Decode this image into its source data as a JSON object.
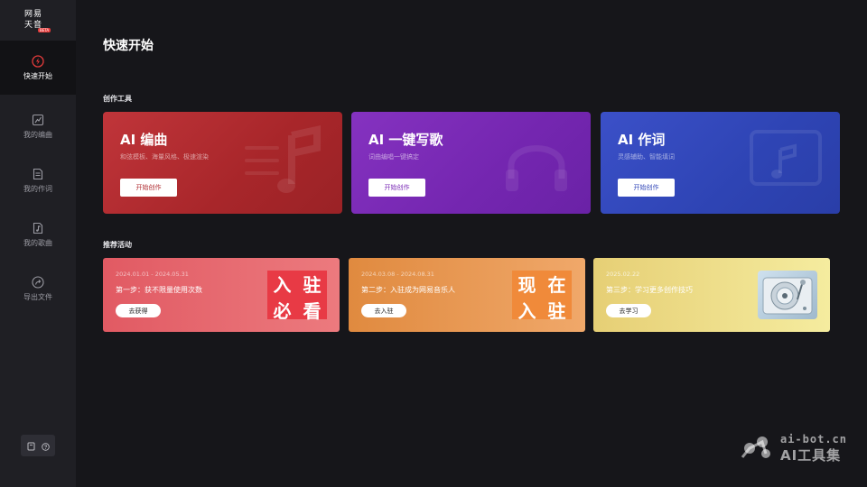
{
  "logo": {
    "line1": "网易",
    "line2": "天音",
    "badge": "BETA"
  },
  "sidebar": {
    "items": [
      {
        "label": "快速开始",
        "icon": "lightning-icon"
      },
      {
        "label": "我的编曲",
        "icon": "score-icon"
      },
      {
        "label": "我的作词",
        "icon": "lyrics-document-icon"
      },
      {
        "label": "我的歌曲",
        "icon": "song-file-icon"
      },
      {
        "label": "导出文件",
        "icon": "export-icon"
      }
    ],
    "tools": [
      {
        "icon": "book-icon"
      },
      {
        "icon": "help-icon"
      }
    ]
  },
  "main": {
    "title": "快速开始",
    "tools_section": "创作工具",
    "activities_section": "推荐活动"
  },
  "tool_cards": [
    {
      "title": "AI 编曲",
      "desc": "和弦模板、海量风格、极速渲染",
      "button": "开始创作",
      "accent": "#b02c31"
    },
    {
      "title": "AI 一键写歌",
      "desc": "词曲编唱一键搞定",
      "button": "开始创作",
      "accent": "#7a2ab6"
    },
    {
      "title": "AI 作词",
      "desc": "灵感辅助、智能填词",
      "button": "开始创作",
      "accent": "#3247b8"
    }
  ],
  "activities": [
    {
      "date": "2024.01.01 - 2024.05.31",
      "text": "第一步：获不限量使用次数",
      "button": "去获得",
      "stamp": [
        "入",
        "驻",
        "必",
        "看"
      ]
    },
    {
      "date": "2024.03.08 - 2024.08.31",
      "text": "第二步：入驻成为网易音乐人",
      "button": "去入驻",
      "stamp": [
        "现",
        "在",
        "入",
        "驻"
      ]
    },
    {
      "date": "2025.02.22",
      "text": "第三步：学习更多创作技巧",
      "button": "去学习"
    }
  ],
  "watermark": {
    "line1": "ai-bot.cn",
    "line2": "AI工具集"
  }
}
